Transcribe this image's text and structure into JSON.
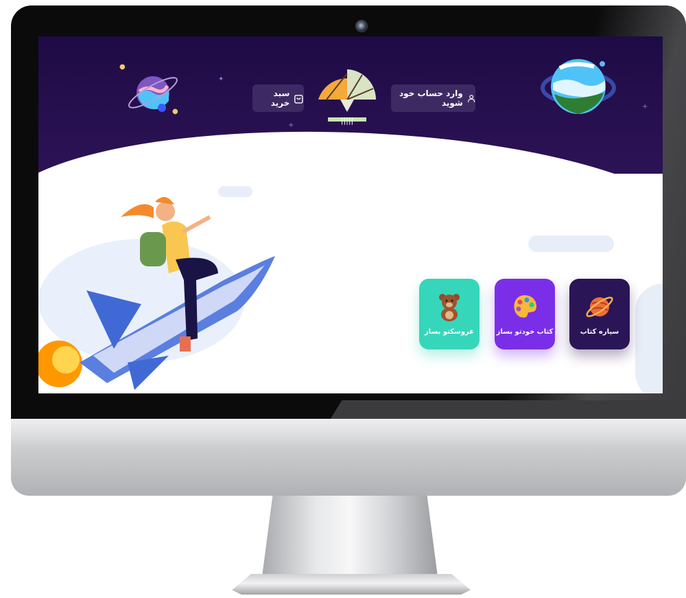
{
  "header": {
    "login_label": "وارد حساب خود شوید",
    "cart_label": "سبد خرید"
  },
  "tiles": [
    {
      "label": "سیاره کتاب",
      "icon": "planet-icon",
      "color": "#2a1656"
    },
    {
      "label": "کتاب خودتو بساز",
      "icon": "paint-palette-icon",
      "color": "#7b2ee8"
    },
    {
      "label": "عروسکتو بساز",
      "icon": "teddy-bear-icon",
      "color": "#36d6ba"
    }
  ],
  "colors": {
    "header_bg": "#1e0b45",
    "header_button_bg": "#3e2a63"
  }
}
